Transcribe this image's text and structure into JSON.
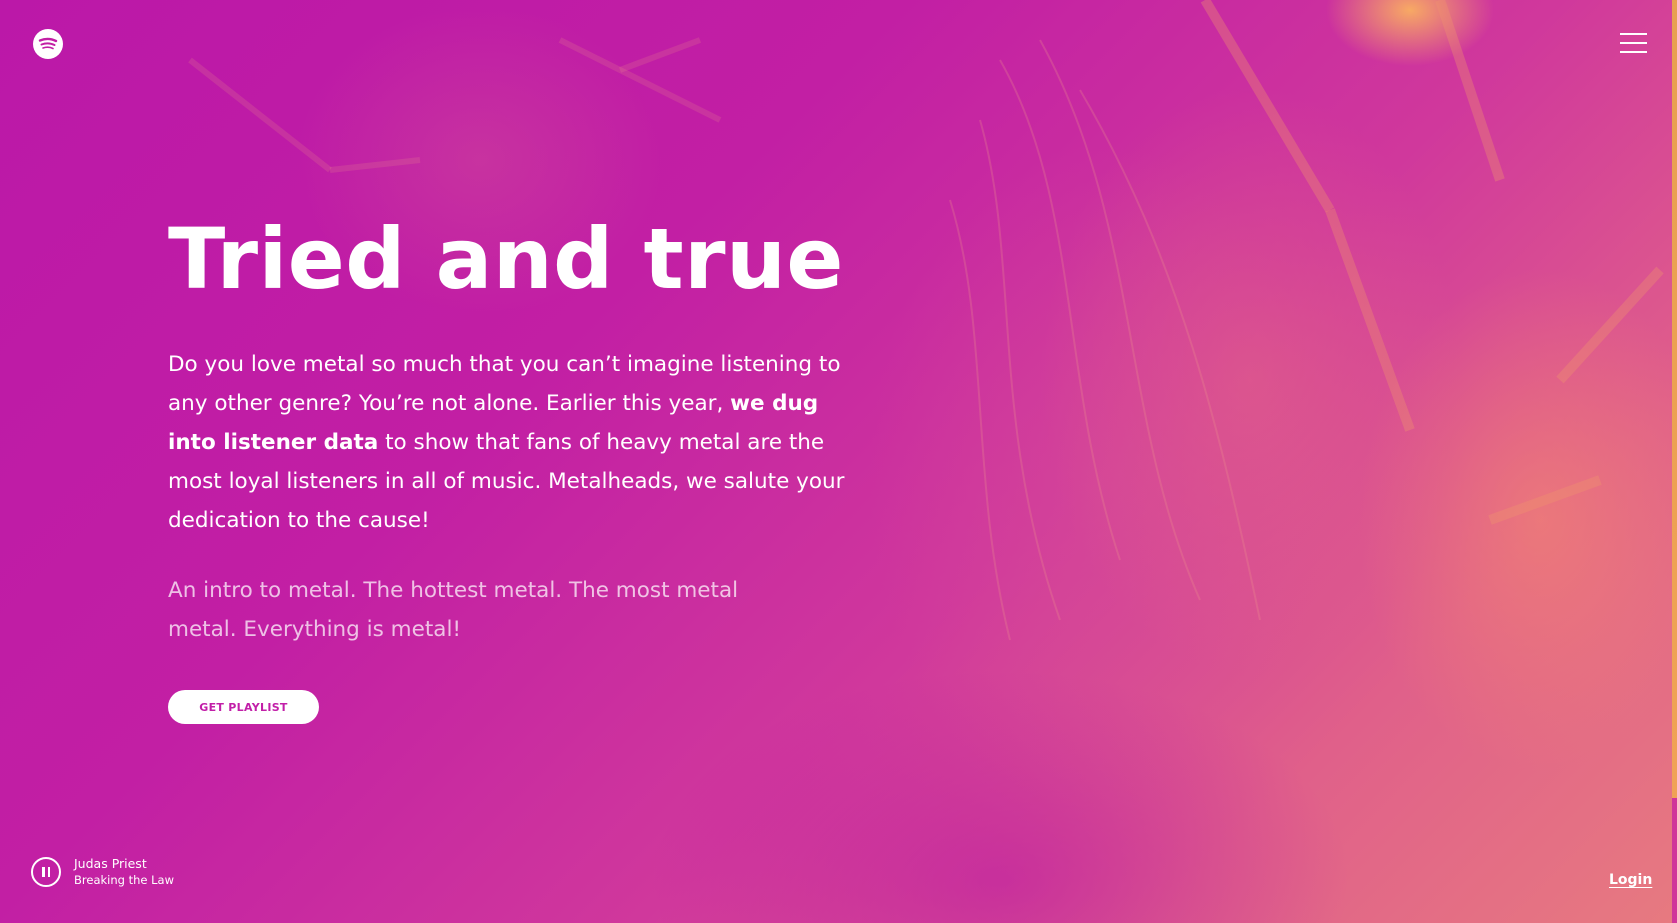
{
  "header": {
    "logo_icon": "spotify-logo-icon",
    "menu_icon": "hamburger-menu-icon"
  },
  "hero": {
    "title": "Tried and true",
    "body": {
      "part1": "Do you love metal so much that you can’t imagine listening to any other genre? You’re not alone. Earlier this year, ",
      "bold": "we dug into listener data",
      "part2": " to show that fans of heavy metal are the most loyal listeners in all of music. Metalheads, we salute your dedication to the cause!"
    },
    "secondary": "An intro to metal. The hottest metal. The most metal metal. Everything is metal!",
    "cta_label": "GET PLAYLIST"
  },
  "player": {
    "control_icon": "pause-icon",
    "artist": "Judas Priest",
    "song": "Breaking the Law"
  },
  "footer": {
    "login_label": "Login"
  },
  "colors": {
    "background_primary": "#c21fa4",
    "background_secondary": "#e77a80",
    "accent_orange": "#f0a255",
    "text": "#ffffff",
    "button_text": "#c21fa8"
  }
}
